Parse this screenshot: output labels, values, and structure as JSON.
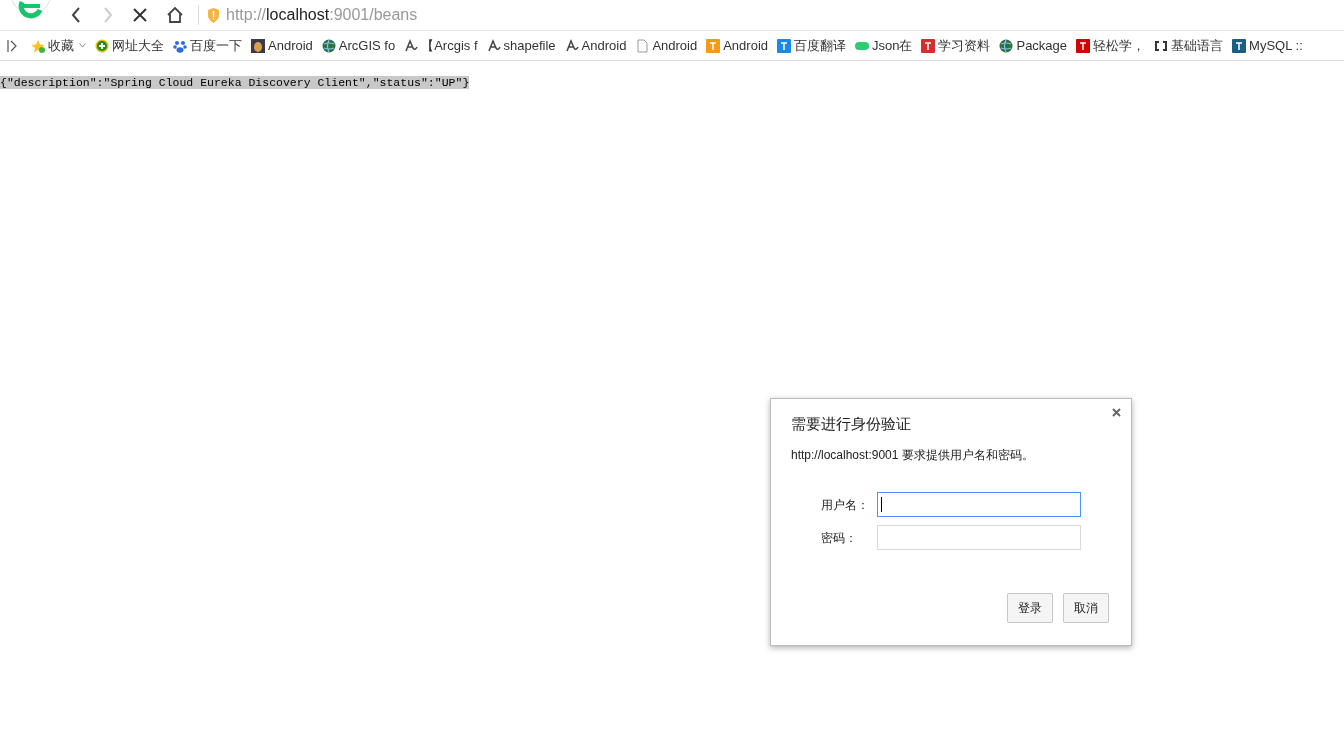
{
  "toolbar": {
    "url_scheme": "http://",
    "url_host": "localhost",
    "url_rest": ":9001/beans",
    "loading": true
  },
  "bookmarks": [
    {
      "label": "收藏",
      "kind": "star",
      "dropdown": true
    },
    {
      "label": "网址大全",
      "kind": "plus"
    },
    {
      "label": "百度一下",
      "kind": "paw"
    },
    {
      "label": "Android",
      "kind": "photo"
    },
    {
      "label": "ArcGIS fo",
      "kind": "globe"
    },
    {
      "label": "【Arcgis f",
      "kind": "script"
    },
    {
      "label": "shapefile",
      "kind": "script"
    },
    {
      "label": "Android",
      "kind": "script"
    },
    {
      "label": "Android",
      "kind": "file"
    },
    {
      "label": "Android",
      "kind": "square",
      "color": "#f39c12"
    },
    {
      "label": "百度翻译",
      "kind": "square",
      "color": "#1e88e5"
    },
    {
      "label": "Json在",
      "kind": "pill",
      "color": "#2ecc71"
    },
    {
      "label": "学习资料",
      "kind": "square",
      "color": "#d32f2f"
    },
    {
      "label": "Package",
      "kind": "globe"
    },
    {
      "label": "轻松学，",
      "kind": "square",
      "color": "#d50000"
    },
    {
      "label": "基础语言",
      "kind": "brackets"
    },
    {
      "label": "MySQL ::",
      "kind": "square",
      "color": "#1c5d84"
    }
  ],
  "page": {
    "body_text": "{\"description\":\"Spring Cloud Eureka Discovery Client\",\"status\":\"UP\"}",
    "selected": true
  },
  "dialog": {
    "title": "需要进行身份验证",
    "message": "http://localhost:9001 要求提供用户名和密码。",
    "fields": [
      {
        "label": "用户名：",
        "focused": true
      },
      {
        "label": "密码：",
        "focused": false
      }
    ],
    "buttons": [
      "登录",
      "取消"
    ]
  }
}
